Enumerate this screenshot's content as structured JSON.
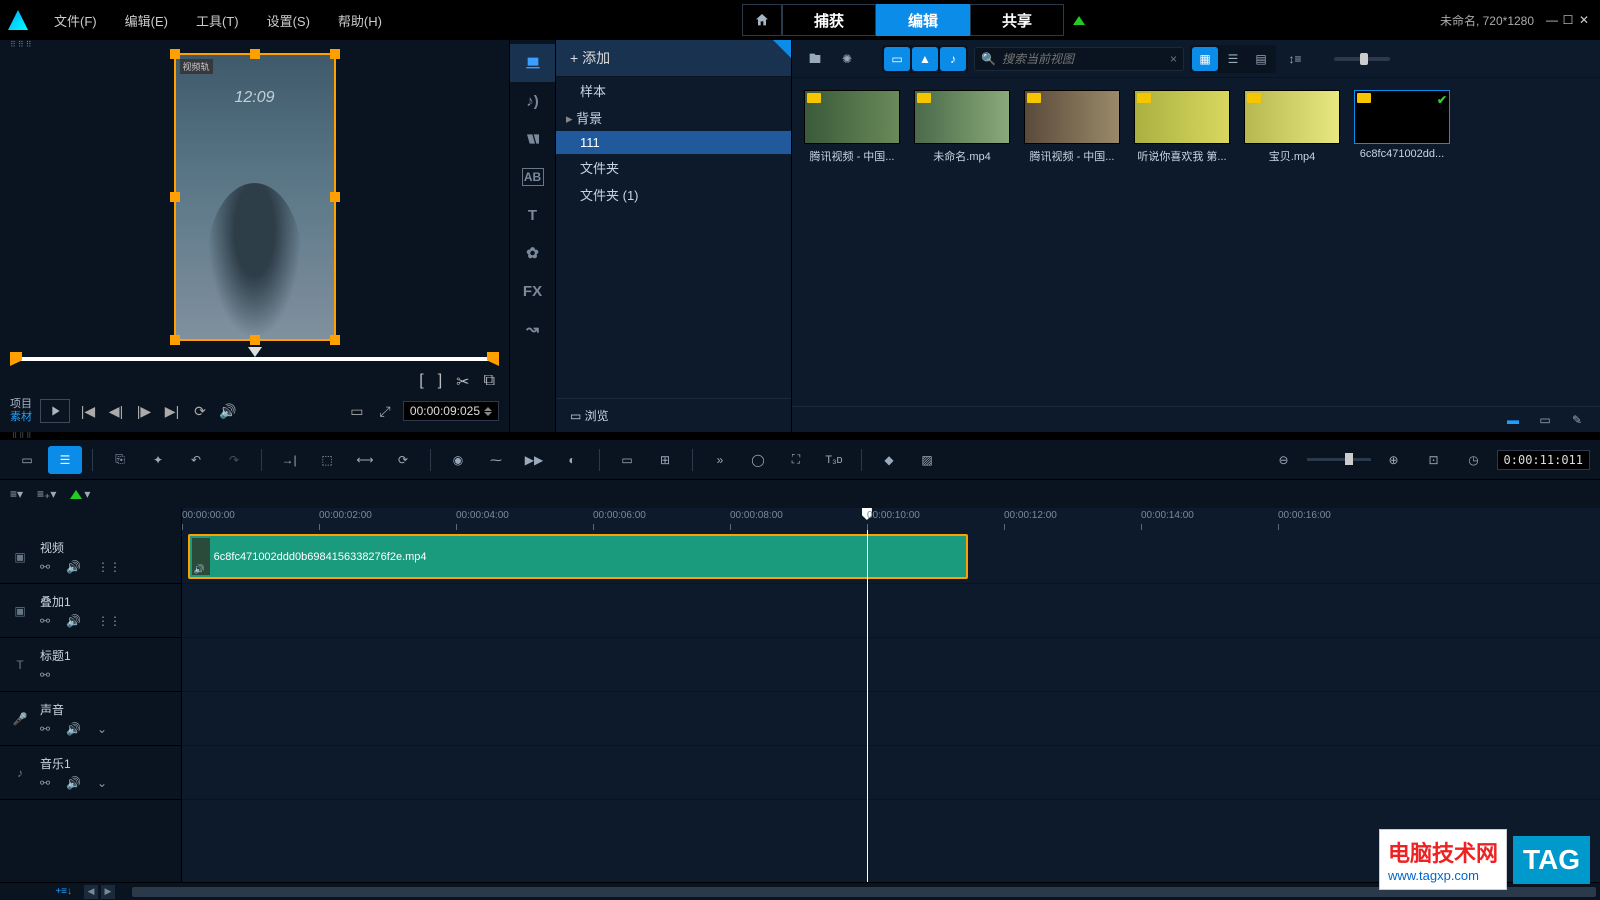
{
  "menubar": [
    "文件(F)",
    "编辑(E)",
    "工具(T)",
    "设置(S)",
    "帮助(H)"
  ],
  "top_tabs": {
    "capture": "捕获",
    "edit": "编辑",
    "share": "共享"
  },
  "project_info": "未命名, 720*1280",
  "preview": {
    "project_label": "项目",
    "material_label": "素材",
    "timecode": "00:00:09:025",
    "badge": "视频轨",
    "overlay_time": "12:09"
  },
  "library": {
    "add": "+  添加",
    "tree": {
      "sample": "样本",
      "background": "背景",
      "folder111": "111",
      "folder": "文件夹",
      "folder1": "文件夹 (1)"
    },
    "browse": "浏览",
    "search_placeholder": "搜索当前视图",
    "items": [
      {
        "label": "腾讯视频 - 中国..."
      },
      {
        "label": "未命名.mp4"
      },
      {
        "label": "腾讯视频 - 中国..."
      },
      {
        "label": "听说你喜欢我 第..."
      },
      {
        "label": "宝贝.mp4"
      },
      {
        "label": "6c8fc471002dd...",
        "selected": true
      }
    ],
    "fx_label": "FX"
  },
  "timeline": {
    "timecode": "0:00:11:011",
    "ruler": [
      "00:00:00:00",
      "00:00:02:00",
      "00:00:04:00",
      "00:00:06:00",
      "00:00:08:00",
      "00:00:10:00",
      "00:00:12:00",
      "00:00:14:00",
      "00:00:16:00"
    ],
    "playhead_pct": 48.3,
    "clip": {
      "name": "6c8fc471002ddd0b6984156338276f2e.mp4",
      "left_pct": 0.4,
      "width_pct": 55.0
    },
    "tracks": [
      {
        "name": "视频",
        "icons": [
          "link",
          "vol",
          "grid"
        ]
      },
      {
        "name": "叠加1",
        "icons": [
          "link",
          "vol",
          "grid"
        ]
      },
      {
        "name": "标题1",
        "icons": [
          "link"
        ]
      },
      {
        "name": "声音",
        "icons": [
          "link",
          "vol",
          "chev"
        ]
      },
      {
        "name": "音乐1",
        "icons": [
          "link",
          "vol",
          "chev"
        ]
      }
    ],
    "track_type_icons": [
      "film",
      "film",
      "text",
      "mic",
      "note"
    ]
  },
  "watermark": {
    "title": "电脑技术网",
    "url": "www.tagxp.com",
    "tag": "TAG"
  }
}
